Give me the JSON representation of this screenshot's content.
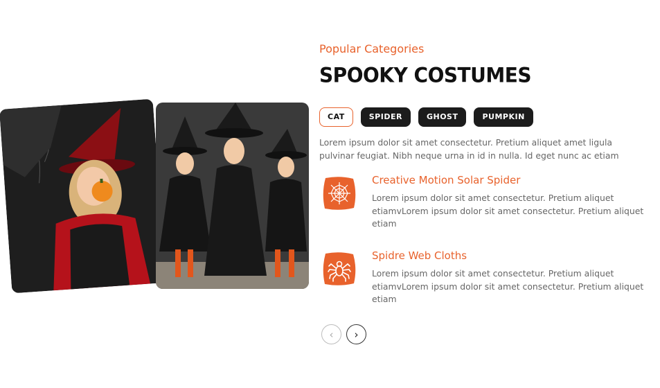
{
  "section": {
    "eyebrow": "Popular Categories",
    "title": "Spooky Costumes"
  },
  "tags": [
    {
      "label": "Cat",
      "active": true
    },
    {
      "label": "Spider",
      "active": false
    },
    {
      "label": "Ghost",
      "active": false
    },
    {
      "label": "Pumpkin",
      "active": false
    }
  ],
  "intro": "Lorem ipsum dolor sit amet consectetur. Pretium aliquet amet ligula pulvinar feugiat. Nibh neque urna in id in nulla. Id eget nunc ac etiam",
  "features": [
    {
      "icon": "spider-web-icon",
      "title": "Creative Motion Solar Spider",
      "text": "Lorem ipsum dolor sit amet consectetur. Pretium aliquet etiamvLorem ipsum dolor sit amet consectetur. Pretium aliquet etiam"
    },
    {
      "icon": "spider-icon",
      "title": "Spidre Web Cloths",
      "text": "Lorem ipsum dolor sit amet consectetur. Pretium aliquet etiamvLorem ipsum dolor sit amet consectetur. Pretium aliquet etiam"
    }
  ],
  "nav": {
    "prev_icon": "chevron-left-icon",
    "next_icon": "chevron-right-icon",
    "prev": "‹",
    "next": "›"
  },
  "colors": {
    "accent": "#e8622c",
    "dark": "#1c1c1c",
    "body_text": "#666666"
  }
}
